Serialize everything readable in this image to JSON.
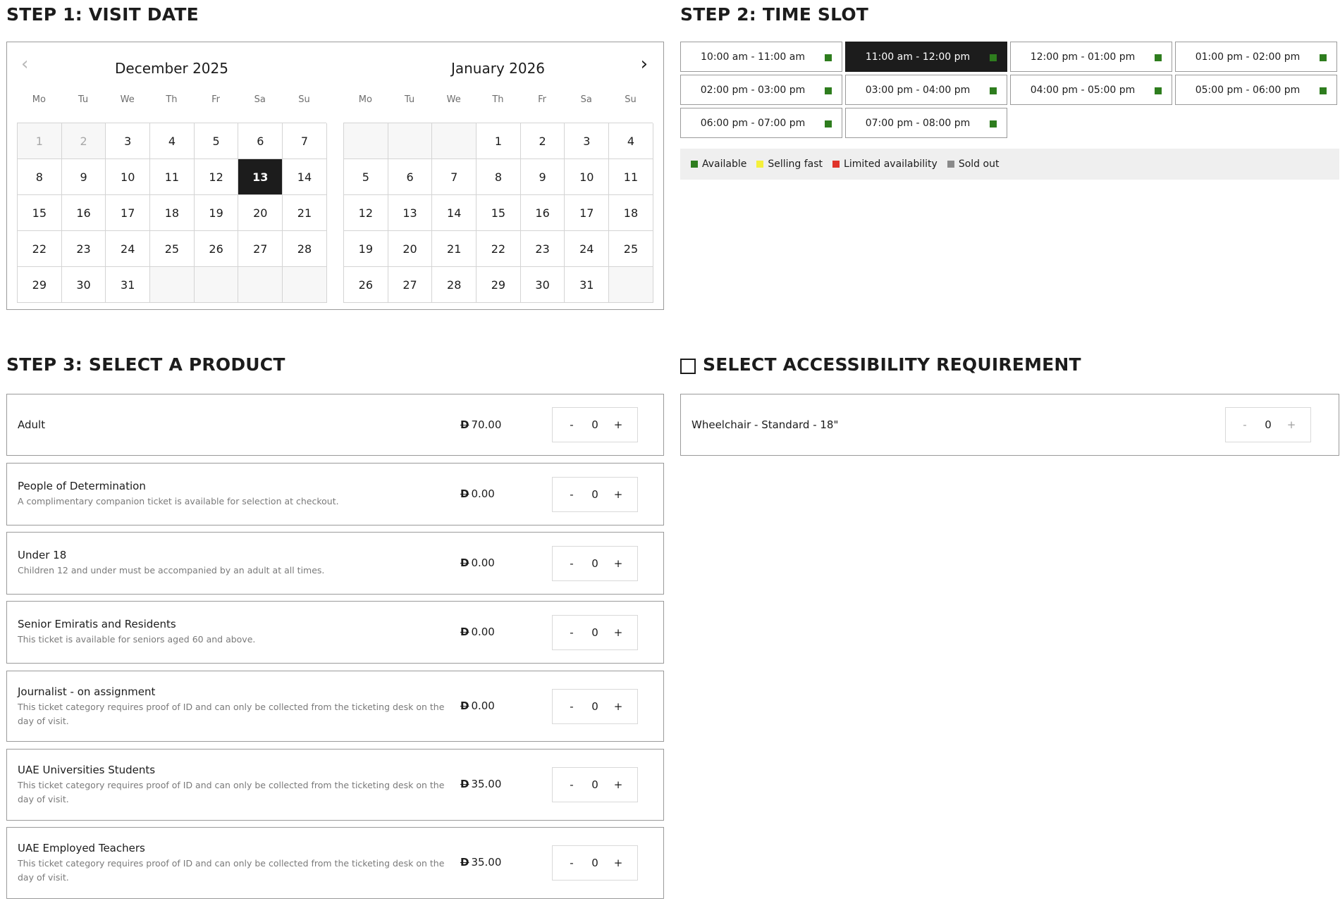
{
  "step1": {
    "title": "STEP 1: VISIT DATE"
  },
  "step2": {
    "title": "STEP 2: TIME SLOT"
  },
  "step3": {
    "title": "STEP 3: SELECT A PRODUCT"
  },
  "accessibility": {
    "title": "SELECT ACCESSIBILITY REQUIREMENT",
    "item": {
      "name": "Wheelchair - Standard - 18\"",
      "quantity": "0"
    }
  },
  "calendar": {
    "weekdays": [
      "Mo",
      "Tu",
      "We",
      "Th",
      "Fr",
      "Sa",
      "Su"
    ],
    "prev_icon": "chevron-left-icon",
    "next_icon": "chevron-right-icon",
    "months": [
      {
        "title": "December 2025",
        "days": [
          "1",
          "2",
          "3",
          "4",
          "5",
          "6",
          "7",
          "8",
          "9",
          "10",
          "11",
          "12",
          "13",
          "14",
          "15",
          "16",
          "17",
          "18",
          "19",
          "20",
          "21",
          "22",
          "23",
          "24",
          "25",
          "26",
          "27",
          "28",
          "29",
          "30",
          "31",
          "",
          "",
          "",
          ""
        ],
        "past": [
          "1",
          "2"
        ],
        "selected": "13"
      },
      {
        "title": "January 2026",
        "days": [
          "",
          "",
          "",
          "1",
          "2",
          "3",
          "4",
          "5",
          "6",
          "7",
          "8",
          "9",
          "10",
          "11",
          "12",
          "13",
          "14",
          "15",
          "16",
          "17",
          "18",
          "19",
          "20",
          "21",
          "22",
          "23",
          "24",
          "25",
          "26",
          "27",
          "28",
          "29",
          "30",
          "31",
          ""
        ],
        "past": [],
        "selected": ""
      }
    ]
  },
  "timeslots": [
    {
      "label": "10:00 am - 11:00 am",
      "selected": false
    },
    {
      "label": "11:00 am - 12:00 pm",
      "selected": true
    },
    {
      "label": "12:00 pm - 01:00 pm",
      "selected": false
    },
    {
      "label": "01:00 pm - 02:00 pm",
      "selected": false
    },
    {
      "label": "02:00 pm - 03:00 pm",
      "selected": false
    },
    {
      "label": "03:00 pm - 04:00 pm",
      "selected": false
    },
    {
      "label": "04:00 pm - 05:00 pm",
      "selected": false
    },
    {
      "label": "05:00 pm - 06:00 pm",
      "selected": false
    },
    {
      "label": "06:00 pm - 07:00 pm",
      "selected": false
    },
    {
      "label": "07:00 pm - 08:00 pm",
      "selected": false
    }
  ],
  "legend": [
    {
      "label": "Available",
      "color": "#2e7d1e"
    },
    {
      "label": "Selling fast",
      "color": "#f5f03c"
    },
    {
      "label": "Limited availability",
      "color": "#e0332a"
    },
    {
      "label": "Sold out",
      "color": "#8a8a8a"
    }
  ],
  "currency_symbol": "D",
  "stepper": {
    "minus": "-",
    "plus": "+"
  },
  "products": [
    {
      "name": "Adult",
      "description": "",
      "price": "70.00",
      "quantity": "0"
    },
    {
      "name": "People of Determination",
      "description": "A complimentary companion ticket is available for selection at checkout.",
      "price": "0.00",
      "quantity": "0"
    },
    {
      "name": "Under 18",
      "description": "Children 12 and under must be accompanied by an adult at all times.",
      "price": "0.00",
      "quantity": "0"
    },
    {
      "name": "Senior Emiratis and Residents",
      "description": "This ticket is available for seniors aged 60 and above.",
      "price": "0.00",
      "quantity": "0"
    },
    {
      "name": "Journalist - on assignment",
      "description": "This ticket category requires proof of ID and can only be collected from the ticketing desk on the day of visit.",
      "price": "0.00",
      "quantity": "0"
    },
    {
      "name": "UAE Universities Students",
      "description": "This ticket category requires proof of ID and can only be collected from the ticketing desk on the day of visit.",
      "price": "35.00",
      "quantity": "0"
    },
    {
      "name": "UAE Employed Teachers",
      "description": "This ticket category requires proof of ID and can only be collected from the ticketing desk on the day of visit.",
      "price": "35.00",
      "quantity": "0"
    }
  ]
}
